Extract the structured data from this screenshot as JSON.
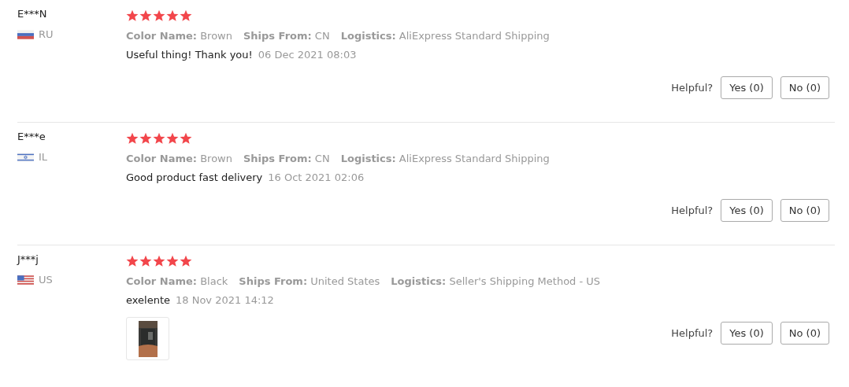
{
  "reviews": [
    {
      "name": "E***N",
      "flag": {
        "kind": "ru"
      },
      "country": "RU",
      "stars": 5,
      "meta": [
        {
          "label": "Color Name:",
          "value": "Brown"
        },
        {
          "label": "Ships From:",
          "value": "CN"
        },
        {
          "label": "Logistics:",
          "value": "AliExpress Standard Shipping"
        }
      ],
      "text": "Useful thing! Thank you!",
      "date": "06 Dec 2021 08:03",
      "helpful": "Helpful?",
      "yes": "Yes (0)",
      "no": "No (0)"
    },
    {
      "name": "E***e",
      "flag": {
        "kind": "il"
      },
      "country": "IL",
      "stars": 5,
      "meta": [
        {
          "label": "Color Name:",
          "value": "Brown"
        },
        {
          "label": "Ships From:",
          "value": "CN"
        },
        {
          "label": "Logistics:",
          "value": "AliExpress Standard Shipping"
        }
      ],
      "text": "Good product fast delivery",
      "date": "16 Oct 2021 02:06",
      "helpful": "Helpful?",
      "yes": "Yes (0)",
      "no": "No (0)"
    },
    {
      "name": "J***j",
      "flag": {
        "kind": "us"
      },
      "country": "US",
      "stars": 5,
      "meta": [
        {
          "label": "Color Name:",
          "value": "Black"
        },
        {
          "label": "Ships From:",
          "value": "United States"
        },
        {
          "label": "Logistics:",
          "value": "Seller's Shipping Method - US"
        }
      ],
      "text": "exelente",
      "date": "18 Nov 2021 14:12",
      "photos": [
        {
          "kind": "picture"
        }
      ],
      "helpful": "Helpful?",
      "yes": "Yes (0)",
      "no": "No (0)"
    }
  ]
}
